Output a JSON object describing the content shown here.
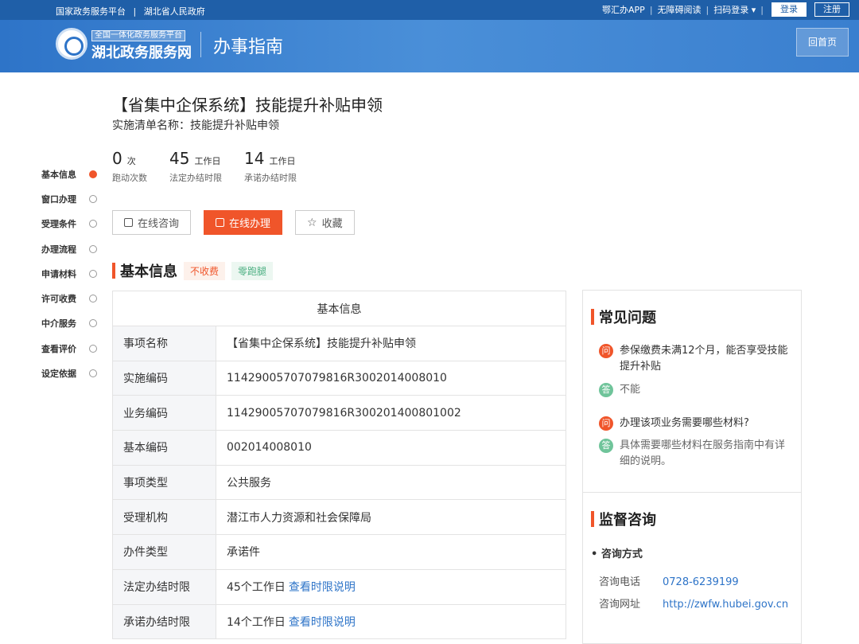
{
  "topbar": {
    "links_left": [
      "国家政务服务平台",
      "|",
      "湖北省人民政府"
    ],
    "app": "鄂汇办APP",
    "sep1": "|",
    "accessible": "无障碍阅读",
    "sep2": "|",
    "qr_login": "扫码登录 ▾",
    "sep3": "|",
    "login": "登录",
    "register": "注册"
  },
  "header": {
    "tag": "全国一体化政务服务平台",
    "site_name": "湖北政务服务网",
    "title": "办事指南",
    "home_button": "回首页"
  },
  "page": {
    "title": "【省集中企保系统】技能提升补贴申领",
    "subtitle": "实施清单名称：技能提升补贴申领"
  },
  "sidenav": [
    {
      "label": "基本信息",
      "active": true
    },
    {
      "label": "窗口办理",
      "active": false
    },
    {
      "label": "受理条件",
      "active": false
    },
    {
      "label": "办理流程",
      "active": false
    },
    {
      "label": "申请材料",
      "active": false
    },
    {
      "label": "许可收费",
      "active": false
    },
    {
      "label": "中介服务",
      "active": false
    },
    {
      "label": "查看评价",
      "active": false
    },
    {
      "label": "设定依据",
      "active": false
    }
  ],
  "stats": [
    {
      "num": "0",
      "unit": "次",
      "label": "跑动次数"
    },
    {
      "num": "45",
      "unit": "工作日",
      "label": "法定办结时限"
    },
    {
      "num": "14",
      "unit": "工作日",
      "label": "承诺办结时限"
    }
  ],
  "actions": {
    "consult": "在线咨询",
    "apply": "在线办理",
    "favorite": "收藏"
  },
  "section": {
    "title": "基本信息",
    "tag_fee": "不收费",
    "tag_run": "零跑腿"
  },
  "table": {
    "header": "基本信息",
    "link_text": "查看时限说明",
    "rows": [
      {
        "k": "事项名称",
        "v": "【省集中企保系统】技能提升补贴申领"
      },
      {
        "k": "实施编码",
        "v": "11429005707079816R3002014008010"
      },
      {
        "k": "业务编码",
        "v": "11429005707079816R300201400801002"
      },
      {
        "k": "基本编码",
        "v": "002014008010"
      },
      {
        "k": "事项类型",
        "v": "公共服务"
      },
      {
        "k": "受理机构",
        "v": "潜江市人力资源和社会保障局"
      },
      {
        "k": "办件类型",
        "v": "承诺件"
      },
      {
        "k": "法定办结时限",
        "v": "45个工作日"
      },
      {
        "k": "承诺办结时限",
        "v": "14个工作日"
      }
    ]
  },
  "faq": {
    "title": "常见问题",
    "q_badge": "问",
    "a_badge": "答",
    "items": [
      {
        "q": "参保缴费未满12个月，能否享受技能提升补贴",
        "a": "不能"
      },
      {
        "q": "办理该项业务需要哪些材料?",
        "a": "具体需要哪些材料在服务指南中有详细的说明。"
      }
    ]
  },
  "supervise": {
    "title": "监督咨询",
    "sub": "• 咨询方式",
    "phone_label": "咨询电话",
    "phone": "0728-6239199",
    "url_label": "咨询网址",
    "url": "http://zwfw.hubei.gov.cn"
  },
  "colors": {
    "accent": "#f0552a",
    "brand": "#1f5fa8",
    "link": "#2e74c8"
  }
}
